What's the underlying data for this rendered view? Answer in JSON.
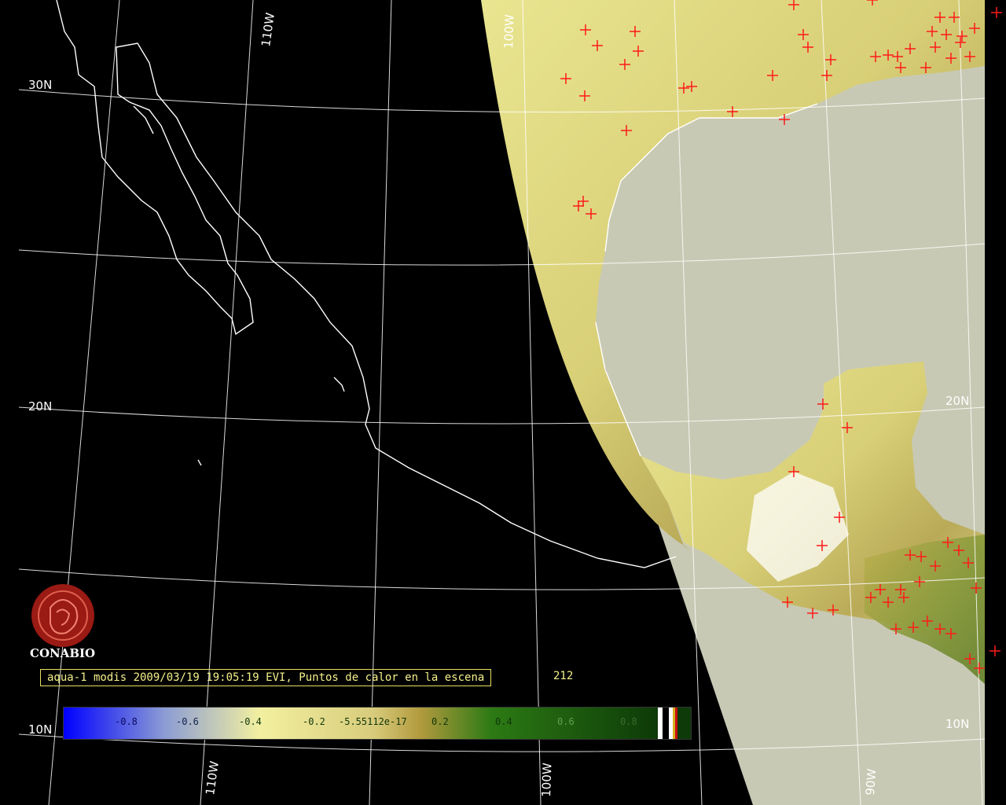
{
  "map": {
    "lat_labels": [
      "30N",
      "20N",
      "20N",
      "10N",
      "10N"
    ],
    "lon_labels": [
      "110W",
      "100W",
      "110W",
      "100W",
      "90W"
    ],
    "colors": {
      "background": "#000000",
      "ocean": "#c8c9b4",
      "coast": "#ffffff",
      "fire_marker": "#ff1a1a",
      "land_yellow": "#e6e28a",
      "land_olive": "#b4a452",
      "land_green": "#6f8a2e"
    }
  },
  "logo": {
    "text": "CONABIO",
    "icon": "conabio-seal-icon",
    "color": "#9a1a14"
  },
  "caption": {
    "text": "aqua-1 modis 2009/03/19 19:05:19 EVI, Puntos de calor en la escena",
    "count": "212"
  },
  "colorbar": {
    "ticks": [
      "-0.8",
      "-0.6",
      "-0.4",
      "-0.2",
      "-5.55112e-17",
      "0.2",
      "0.4",
      "0.6",
      "0.8"
    ],
    "colors": [
      "#0000ff",
      "#8c9cd4",
      "#f2f0a0",
      "#c6ae4e",
      "#1f6a10",
      "#0d3a08"
    ]
  }
}
